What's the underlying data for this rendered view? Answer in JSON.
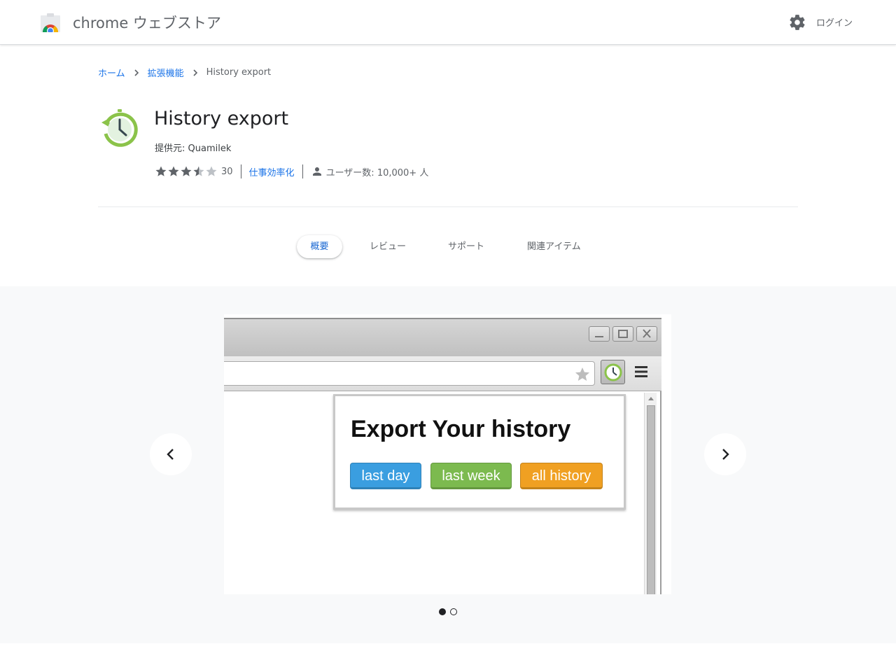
{
  "header": {
    "store_title": "chrome ウェブストア",
    "login_label": "ログイン",
    "settings_icon": "gear-icon"
  },
  "breadcrumb": {
    "home": "ホーム",
    "extensions": "拡張機能",
    "current": "History export"
  },
  "item": {
    "title": "History export",
    "offered_by": "提供元: Quamilek",
    "rating": 3.5,
    "rating_max": 5,
    "rating_count": "30",
    "category": "仕事効率化",
    "users": "ユーザー数: 10,000+ 人"
  },
  "tabs": [
    {
      "label": "概要",
      "active": true
    },
    {
      "label": "レビュー",
      "active": false
    },
    {
      "label": "サポート",
      "active": false
    },
    {
      "label": "関連アイテム",
      "active": false
    }
  ],
  "carousel": {
    "slide_count": 2,
    "active_slide": 1,
    "screenshot": {
      "popup_title": "Export Your history",
      "buttons": [
        {
          "label": "last day",
          "color": "#3a9ee0"
        },
        {
          "label": "last week",
          "color": "#7cba4f"
        },
        {
          "label": "all history",
          "color": "#f0a022"
        }
      ]
    }
  },
  "colors": {
    "link": "#1a73e8",
    "active_tab": "#1967d2",
    "icon_green": "#8bc34a",
    "star": "#5f6368",
    "star_empty": "#bdc1c6"
  }
}
